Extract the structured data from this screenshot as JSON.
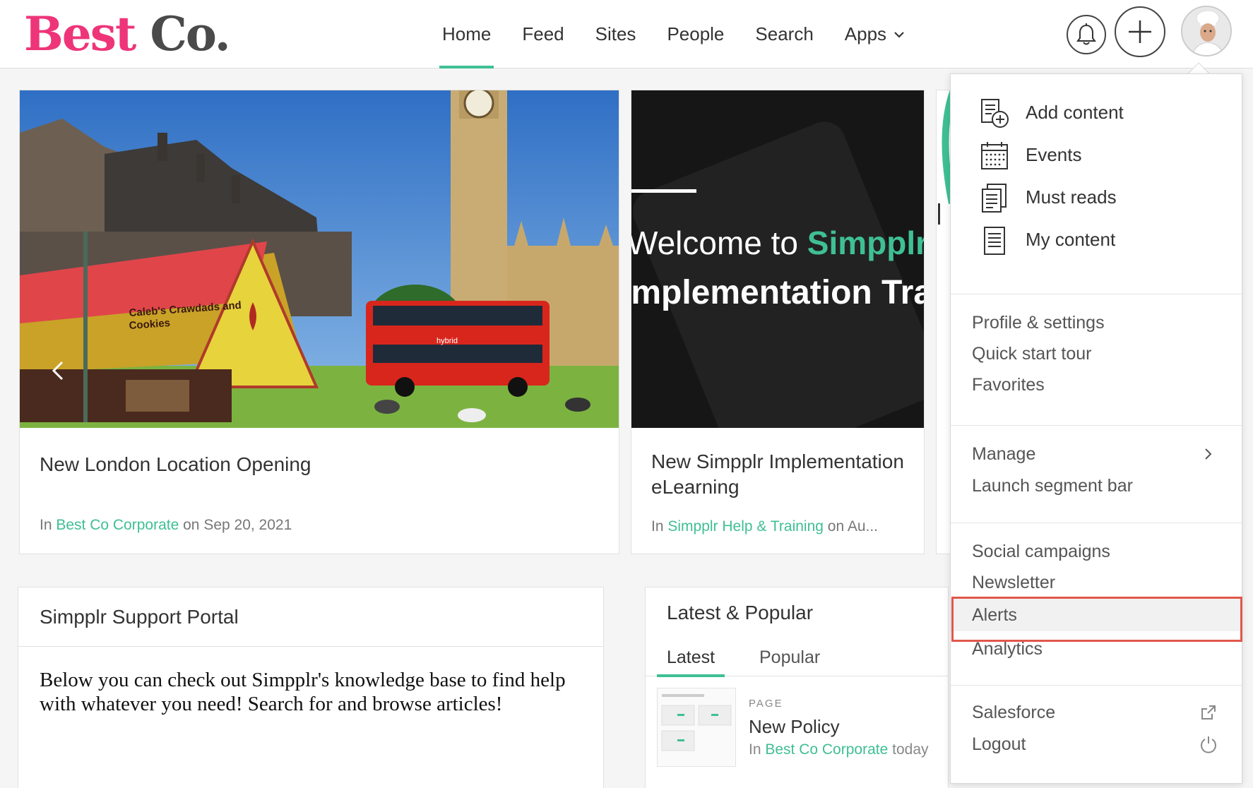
{
  "header": {
    "logo_part1": "Best",
    "logo_part2": "Co.",
    "nav": [
      "Home",
      "Feed",
      "Sites",
      "People",
      "Search",
      "Apps"
    ],
    "active_nav": "Home",
    "accent_color": "#3fbf95",
    "logo_color": "#ee3579"
  },
  "carousel": {
    "cards": [
      {
        "image_sign_line1": "Caleb's Crawdads and",
        "image_sign_line2": "Cookies",
        "image_bus_text": "hybrid",
        "title": "New London Location Opening",
        "meta_in": "In",
        "site": "Best Co Corporate",
        "meta_on": "on Sep 20, 2021"
      },
      {
        "image_text_line1_a": "Welcome to ",
        "image_text_line1_b": "Simpplr",
        "image_text_line2": "Implementation Training",
        "title": "New Simpplr Implementation eLearning",
        "meta_in": "In",
        "site": "Simpplr Help & Training",
        "meta_on": "on Au..."
      }
    ]
  },
  "support": {
    "title": "Simpplr Support Portal",
    "body": "Below you can check out Simpplr's knowledge base to find help with whatever you need! Search for and browse articles!"
  },
  "latest": {
    "title": "Latest & Popular",
    "tabs": [
      "Latest",
      "Popular"
    ],
    "active_tab": "Latest",
    "item": {
      "type": "PAGE",
      "title": "New Policy",
      "meta_in": "In",
      "site": "Best Co Corporate",
      "meta_when": "today"
    }
  },
  "menu": {
    "primary": [
      "Add content",
      "Events",
      "Must reads",
      "My content"
    ],
    "account": [
      "Profile & settings",
      "Quick start tour",
      "Favorites"
    ],
    "admin": [
      "Manage",
      "Launch segment bar"
    ],
    "tools": [
      "Social campaigns",
      "Newsletter",
      "Alerts",
      "Analytics"
    ],
    "footer": [
      "Salesforce",
      "Logout"
    ],
    "highlighted": "Alerts",
    "highlight_color": "#e2574c"
  }
}
